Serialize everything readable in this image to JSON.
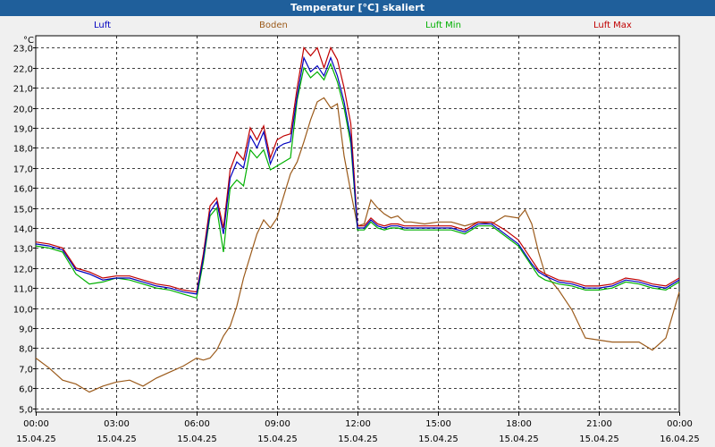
{
  "window": {
    "title": "Temperatur [°C] skaliert"
  },
  "chart_data": {
    "type": "line",
    "title": "Temperatur [°C] skaliert",
    "ylabel": "°C",
    "ylim": [
      4.8,
      23.6
    ],
    "xlim": [
      "2025-04-15 00:00",
      "2025-04-16 00:00"
    ],
    "grid": true,
    "legend_position": "top",
    "yticks": [
      5.0,
      6.0,
      7.0,
      8.0,
      9.0,
      10.0,
      11.0,
      12.0,
      13.0,
      14.0,
      15.0,
      16.0,
      17.0,
      18.0,
      19.0,
      20.0,
      21.0,
      22.0,
      23.0
    ],
    "ytick_labels": [
      "5,0",
      "6,0",
      "7,0",
      "8,0",
      "9,0",
      "10,0",
      "11,0",
      "12,0",
      "13,0",
      "14,0",
      "15,0",
      "16,0",
      "17,0",
      "18,0",
      "19,0",
      "20,0",
      "21,0",
      "22,0",
      "23,0"
    ],
    "xticks": [
      {
        "time": "00:00",
        "date": "15.04.25"
      },
      {
        "time": "03:00",
        "date": "15.04.25"
      },
      {
        "time": "06:00",
        "date": "15.04.25"
      },
      {
        "time": "09:00",
        "date": "15.04.25"
      },
      {
        "time": "12:00",
        "date": "15.04.25"
      },
      {
        "time": "15:00",
        "date": "15.04.25"
      },
      {
        "time": "18:00",
        "date": "15.04.25"
      },
      {
        "time": "21:00",
        "date": "15.04.25"
      },
      {
        "time": "00:00",
        "date": "16.04.25"
      }
    ],
    "x_hours": [
      0,
      0.5,
      1,
      1.5,
      2,
      2.5,
      3,
      3.5,
      4,
      4.5,
      5,
      5.5,
      6,
      6.25,
      6.5,
      6.75,
      7,
      7.25,
      7.5,
      7.75,
      8,
      8.25,
      8.5,
      8.75,
      9,
      9.25,
      9.5,
      9.75,
      10,
      10.25,
      10.5,
      10.75,
      11,
      11.25,
      11.5,
      11.75,
      12,
      12.25,
      12.5,
      12.75,
      13,
      13.25,
      13.5,
      13.75,
      14,
      14.5,
      15,
      15.5,
      16,
      16.5,
      17,
      17.5,
      18,
      18.25,
      18.5,
      18.75,
      19,
      19.5,
      20,
      20.5,
      21,
      21.5,
      22,
      22.5,
      23,
      23.5,
      24
    ],
    "series": [
      {
        "name": "Luft",
        "color": "#0000c0",
        "values": [
          13.2,
          13.1,
          12.9,
          11.9,
          11.7,
          11.4,
          11.5,
          11.5,
          11.3,
          11.1,
          11.0,
          10.8,
          10.7,
          12.5,
          14.8,
          15.3,
          13.7,
          16.5,
          17.3,
          17.0,
          18.6,
          18.0,
          18.8,
          17.2,
          18.0,
          18.2,
          18.3,
          20.6,
          22.5,
          21.8,
          22.1,
          21.6,
          22.5,
          21.6,
          20.3,
          18.5,
          14.0,
          14.0,
          14.4,
          14.1,
          14.0,
          14.1,
          14.1,
          14.0,
          14.0,
          14.0,
          14.0,
          14.0,
          13.8,
          14.2,
          14.2,
          13.7,
          13.2,
          12.7,
          12.2,
          11.8,
          11.6,
          11.3,
          11.2,
          11.0,
          11.0,
          11.1,
          11.4,
          11.3,
          11.1,
          11.0,
          11.4
        ]
      },
      {
        "name": "Boden",
        "color": "#9b5a1a",
        "values": [
          7.5,
          7.0,
          6.4,
          6.2,
          5.8,
          6.1,
          6.3,
          6.4,
          6.1,
          6.5,
          6.8,
          7.1,
          7.5,
          7.4,
          7.5,
          7.9,
          8.6,
          9.1,
          10.1,
          11.5,
          12.6,
          13.7,
          14.4,
          14.0,
          14.5,
          15.6,
          16.7,
          17.3,
          18.3,
          19.4,
          20.3,
          20.5,
          20.0,
          20.2,
          17.6,
          15.8,
          14.1,
          14.2,
          15.4,
          15.0,
          14.7,
          14.5,
          14.6,
          14.3,
          14.3,
          14.2,
          14.3,
          14.3,
          14.1,
          14.3,
          14.2,
          14.6,
          14.5,
          14.9,
          14.2,
          12.8,
          11.7,
          10.9,
          9.9,
          8.5,
          8.4,
          8.3,
          8.3,
          8.3,
          7.9,
          8.5,
          10.8
        ]
      },
      {
        "name": "Luft Min",
        "color": "#00b000",
        "values": [
          13.1,
          13.0,
          12.8,
          11.7,
          11.2,
          11.3,
          11.5,
          11.4,
          11.2,
          11.0,
          10.9,
          10.7,
          10.5,
          12.3,
          14.6,
          15.0,
          12.8,
          16.0,
          16.4,
          16.1,
          17.9,
          17.5,
          17.9,
          16.9,
          17.1,
          17.3,
          17.5,
          20.4,
          22.0,
          21.5,
          21.8,
          21.4,
          22.2,
          21.3,
          20.0,
          18.2,
          13.9,
          13.9,
          14.3,
          14.0,
          13.9,
          14.0,
          14.0,
          13.9,
          13.9,
          13.9,
          13.9,
          13.9,
          13.7,
          14.1,
          14.1,
          13.6,
          13.1,
          12.6,
          12.1,
          11.6,
          11.4,
          11.2,
          11.1,
          10.9,
          10.9,
          11.0,
          11.3,
          11.2,
          11.0,
          10.9,
          11.3
        ]
      },
      {
        "name": "Luft Max",
        "color": "#c00000",
        "values": [
          13.3,
          13.2,
          13.0,
          12.0,
          11.8,
          11.5,
          11.6,
          11.6,
          11.4,
          11.2,
          11.1,
          10.9,
          10.8,
          12.7,
          15.1,
          15.5,
          14.0,
          16.9,
          17.8,
          17.4,
          19.0,
          18.4,
          19.1,
          17.5,
          18.4,
          18.6,
          18.7,
          21.0,
          23.0,
          22.6,
          23.0,
          22.0,
          23.0,
          22.4,
          21.0,
          19.2,
          14.1,
          14.1,
          14.5,
          14.2,
          14.1,
          14.2,
          14.2,
          14.1,
          14.1,
          14.1,
          14.1,
          14.1,
          13.9,
          14.3,
          14.3,
          13.9,
          13.4,
          12.9,
          12.4,
          11.9,
          11.7,
          11.4,
          11.3,
          11.1,
          11.1,
          11.2,
          11.5,
          11.4,
          11.2,
          11.1,
          11.5
        ]
      }
    ]
  }
}
